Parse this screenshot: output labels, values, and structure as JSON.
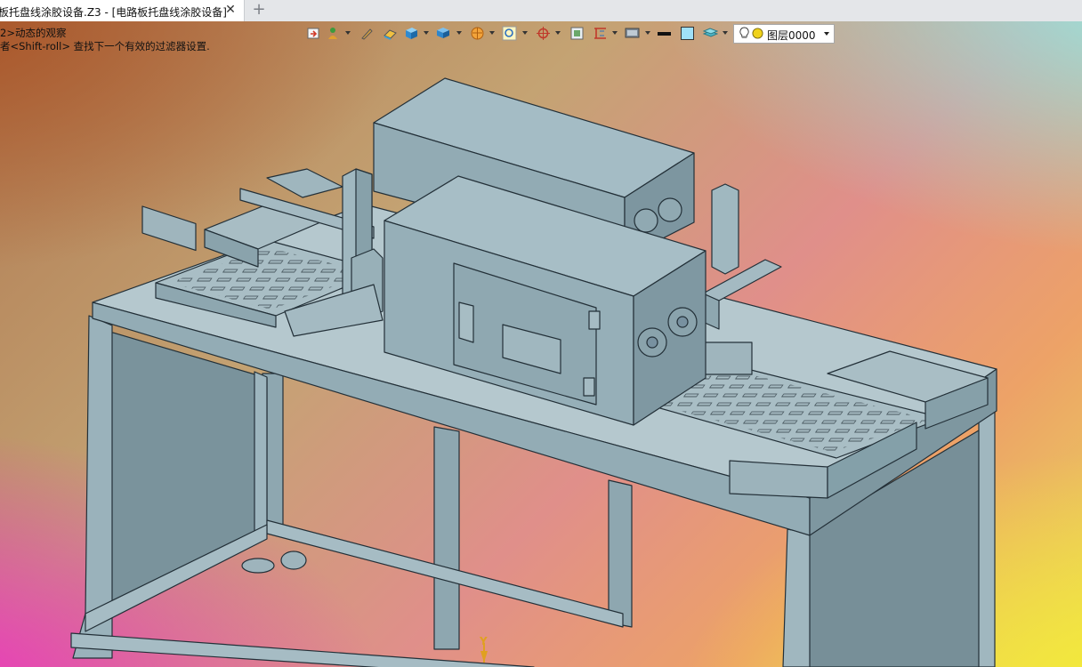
{
  "tab": {
    "title": "板托盘线涂胶设备.Z3 - [电路板托盘线涂胶设备]",
    "close_glyph": "✕",
    "add_glyph": "+"
  },
  "hints": {
    "line1": "2>动态的观察",
    "line2": "者<Shift-roll> 查找下一个有效的过滤器设置."
  },
  "toolbar": {
    "icons": [
      "import-icon",
      "user-pointer-icon",
      "pencil-icon",
      "eraser-icon",
      "cube-icon",
      "view-cube-icon",
      "render-sphere-icon",
      "zoom-icon",
      "snap-target-icon",
      "fit-view-icon",
      "dimension-icon",
      "monitor-icon",
      "line-weight-icon",
      "color-swatch-icon",
      "layers-icon"
    ],
    "layer": {
      "value": "图层0000",
      "bulb_icon": "lightbulb-icon",
      "state_icon": "layer-state-icon"
    }
  },
  "axis": {
    "label": "Y"
  },
  "colors": {
    "model": "#95aeb7",
    "model_dark": "#6f8b95",
    "model_light": "#b9ccd2",
    "edge": "#233038"
  }
}
